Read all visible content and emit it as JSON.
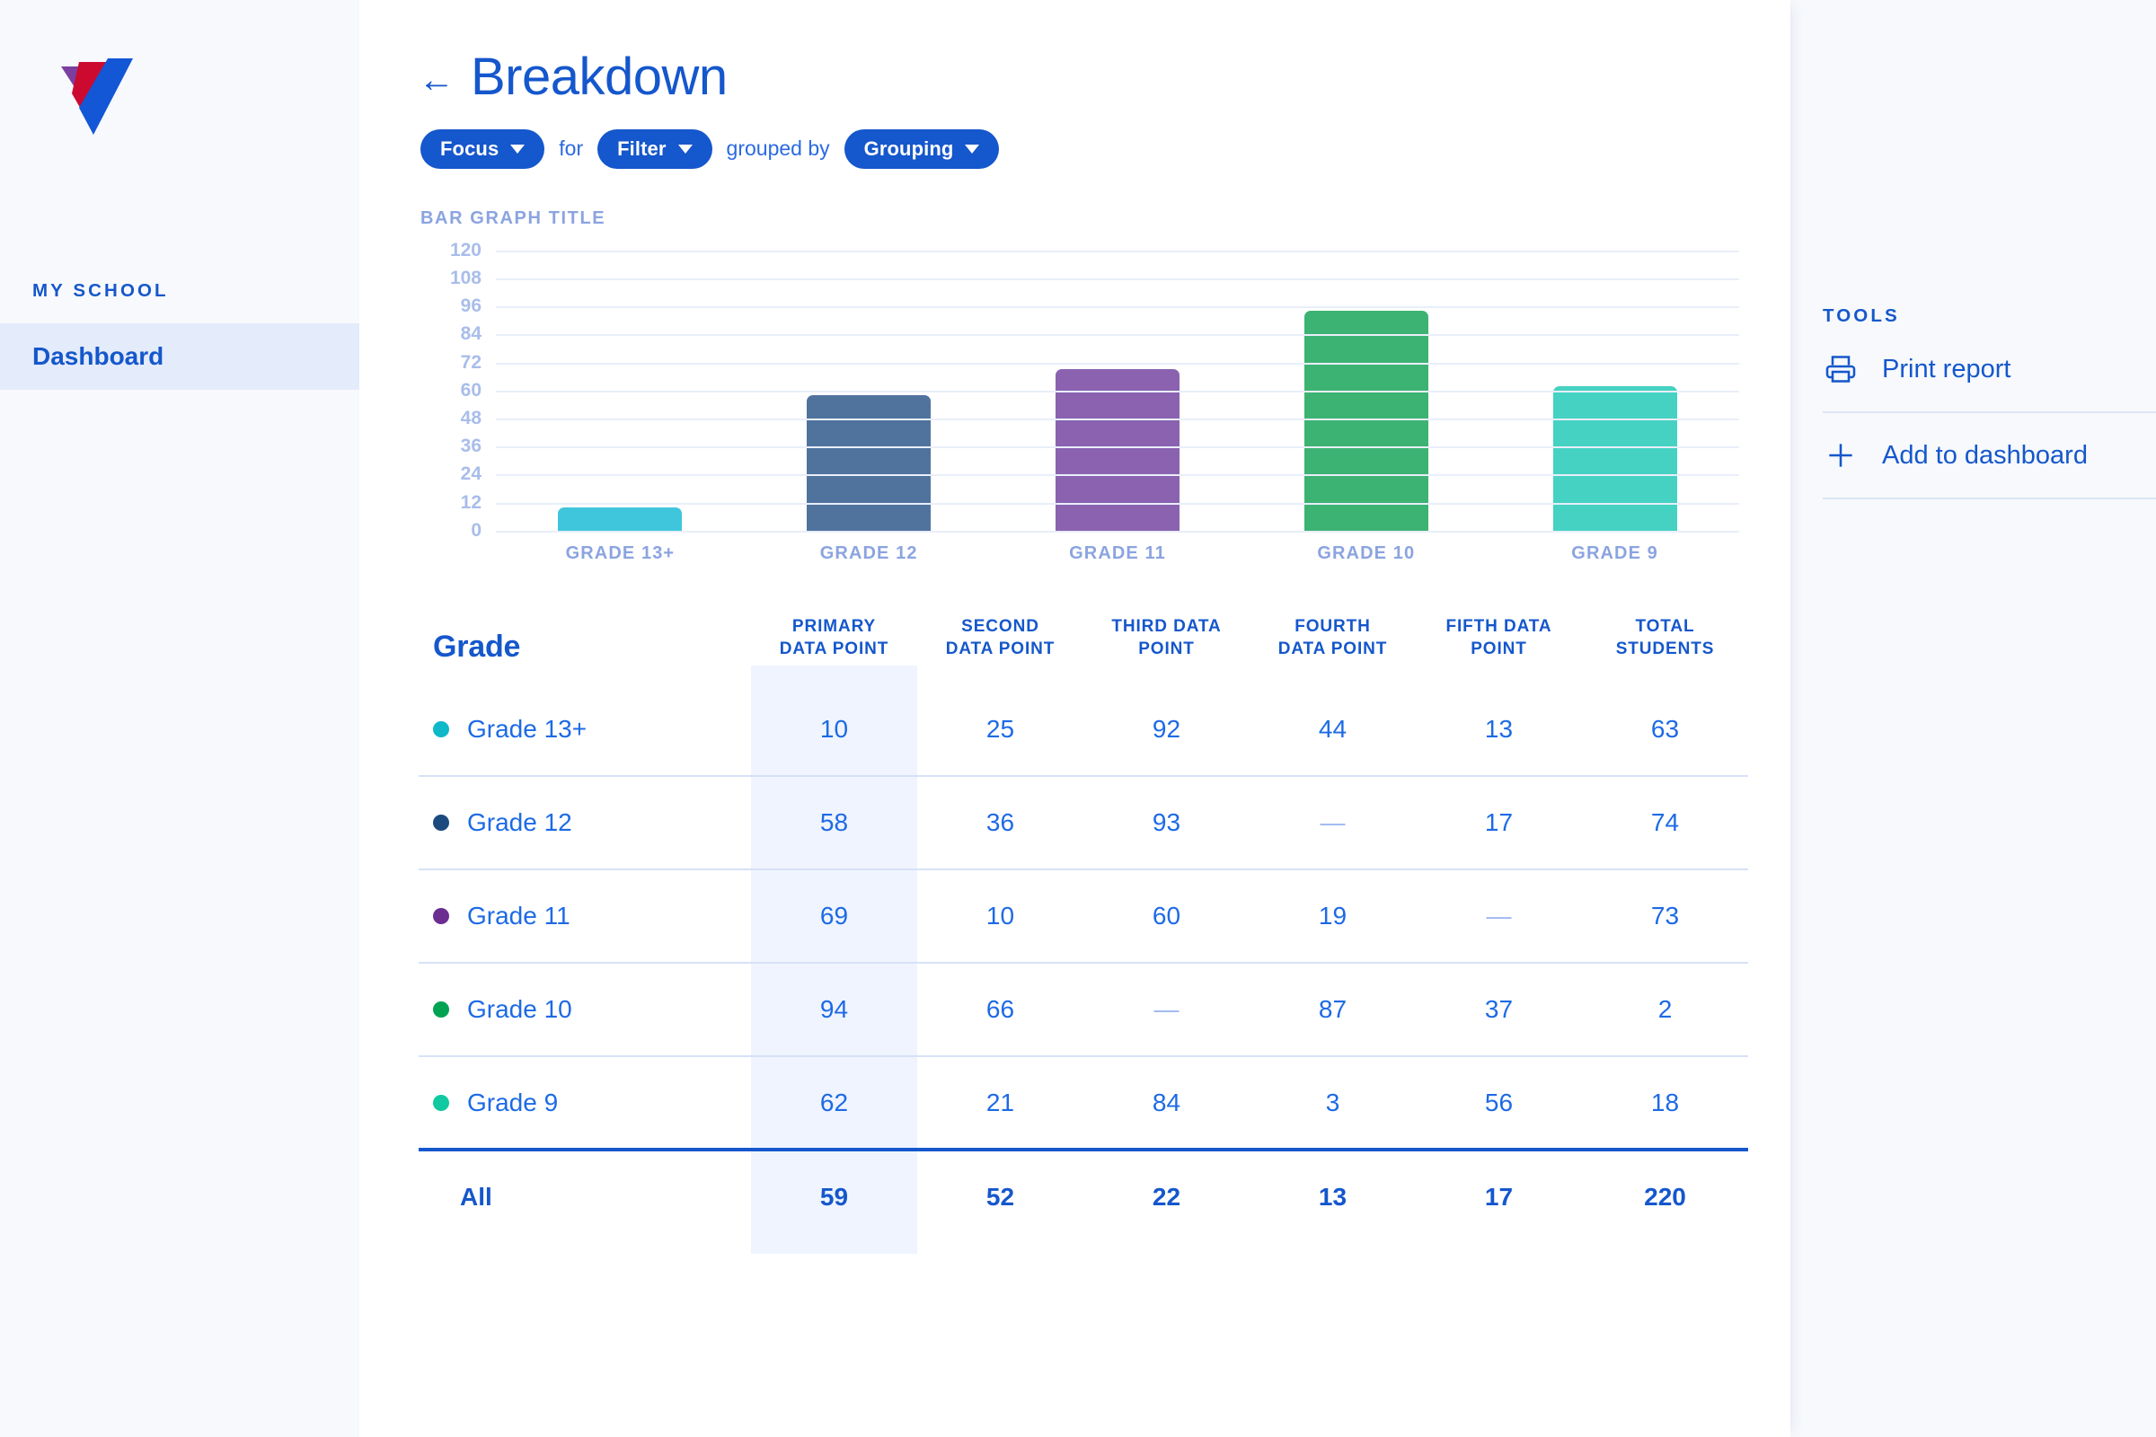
{
  "sidebar": {
    "logo_name": "check-mark-logo",
    "section_label": "MY SCHOOL",
    "items": [
      {
        "label": "Dashboard",
        "active": true
      }
    ]
  },
  "header": {
    "back_icon": "arrow-left-icon",
    "title": "Breakdown"
  },
  "filter_bar": {
    "focus_label": "Focus",
    "conj_for": "for",
    "filter_label": "Filter",
    "conj_grouped_by": "grouped by",
    "grouping_label": "Grouping"
  },
  "tools": {
    "section_label": "TOOLS",
    "items": [
      {
        "label": "Print report",
        "icon": "printer-icon"
      },
      {
        "label": "Add to dashboard",
        "icon": "plus-icon"
      }
    ]
  },
  "chart_data": {
    "type": "bar",
    "title": "BAR GRAPH TITLE",
    "xlabel": "",
    "ylabel": "",
    "ylim": [
      0,
      120
    ],
    "yticks": [
      120,
      108,
      96,
      84,
      72,
      60,
      48,
      36,
      24,
      12,
      0
    ],
    "grid": true,
    "legend": "none",
    "categories": [
      "GRADE 13+",
      "GRADE 12",
      "GRADE 11",
      "GRADE 10",
      "GRADE 9"
    ],
    "values": [
      10,
      58,
      69,
      94,
      62
    ],
    "colors": [
      "#3FC6DC",
      "#50739E",
      "#8A62B0",
      "#3DB373",
      "#45D2C2"
    ]
  },
  "table": {
    "columns": [
      "Grade",
      "PRIMARY DATA POINT",
      "SECOND DATA POINT",
      "THIRD DATA POINT",
      "FOURTH DATA POINT",
      "FIFTH DATA POINT",
      "TOTAL STUDENTS"
    ],
    "column_lines": [
      [
        "Grade"
      ],
      [
        "PRIMARY",
        "DATA POINT"
      ],
      [
        "SECOND",
        "DATA POINT"
      ],
      [
        "THIRD DATA",
        "POINT"
      ],
      [
        "FOURTH",
        "DATA POINT"
      ],
      [
        "FIFTH DATA",
        "POINT"
      ],
      [
        "TOTAL",
        "STUDENTS"
      ]
    ],
    "highlight_column_index": 1,
    "rows": [
      {
        "grade": "Grade 13+",
        "dot": "#0FB8C9",
        "values": [
          "10",
          "25",
          "92",
          "44",
          "13",
          "63"
        ]
      },
      {
        "grade": "Grade 12",
        "dot": "#1C4A7E",
        "values": [
          "58",
          "36",
          "93",
          "—",
          "17",
          "74"
        ]
      },
      {
        "grade": "Grade 11",
        "dot": "#6B2D8F",
        "values": [
          "69",
          "10",
          "60",
          "19",
          "—",
          "73"
        ]
      },
      {
        "grade": "Grade 10",
        "dot": "#00A352",
        "values": [
          "94",
          "66",
          "—",
          "87",
          "37",
          "2"
        ]
      },
      {
        "grade": "Grade 9",
        "dot": "#10C9A0",
        "values": [
          "62",
          "21",
          "84",
          "3",
          "56",
          "18"
        ]
      }
    ],
    "total_row": {
      "grade": "All",
      "values": [
        "59",
        "52",
        "22",
        "13",
        "17",
        "220"
      ]
    }
  },
  "colors": {
    "brand_blue": "#1557CC",
    "link_blue": "#1D6AE5",
    "muted_blue": "#8BA4E0",
    "panel_bg": "#F7F9FC",
    "highlight_band": "#EFF4FE"
  }
}
